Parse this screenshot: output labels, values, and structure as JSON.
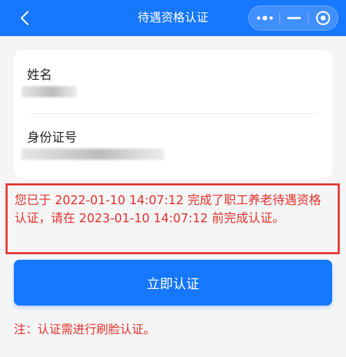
{
  "navbar": {
    "title": "待遇资格认证",
    "back_icon": "chevron-left-icon",
    "capsule": {
      "more_icon": "more-dots-icon",
      "minimize_icon": "minimize-icon",
      "close_icon": "close-target-icon"
    }
  },
  "card": {
    "name_label": "姓名",
    "id_label": "身份证号"
  },
  "notice": {
    "text": "您已于 2022-01-10 14:07:12 完成了职工养老待遇资格认证，请在 2023-01-10 14:07:12 前完成认证。"
  },
  "actions": {
    "certify_label": "立即认证"
  },
  "footer": {
    "note": "注：认证需进行刷脸认证。"
  },
  "colors": {
    "primary": "#1677ff",
    "warning_text": "#e5322d",
    "highlight_border": "#e53935",
    "background": "#f5f5f5"
  }
}
